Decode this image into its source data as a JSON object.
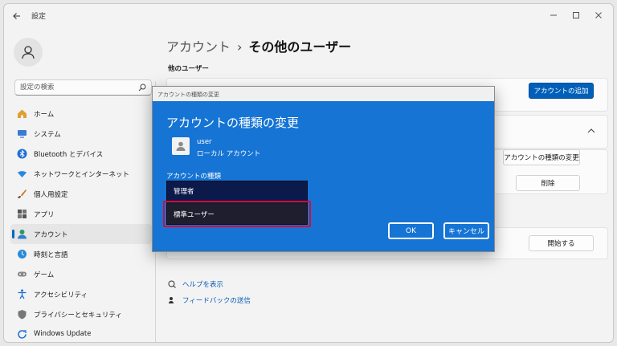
{
  "app": {
    "title": "設定"
  },
  "sidebar": {
    "search_placeholder": "設定の検索",
    "items": [
      {
        "label": "ホーム",
        "icon": "home-icon"
      },
      {
        "label": "システム",
        "icon": "monitor-icon"
      },
      {
        "label": "Bluetooth とデバイス",
        "icon": "bluetooth-icon"
      },
      {
        "label": "ネットワークとインターネット",
        "icon": "wifi-icon"
      },
      {
        "label": "個人用設定",
        "icon": "brush-icon"
      },
      {
        "label": "アプリ",
        "icon": "apps-icon"
      },
      {
        "label": "アカウント",
        "icon": "account-icon",
        "active": true
      },
      {
        "label": "時刻と言語",
        "icon": "globe-clock-icon"
      },
      {
        "label": "ゲーム",
        "icon": "gamepad-icon"
      },
      {
        "label": "アクセシビリティ",
        "icon": "accessibility-icon"
      },
      {
        "label": "プライバシーとセキュリティ",
        "icon": "shield-icon"
      },
      {
        "label": "Windows Update",
        "icon": "update-icon"
      }
    ]
  },
  "main": {
    "breadcrumb_parent": "アカウント",
    "breadcrumb_sep": "›",
    "breadcrumb_current": "その他のユーザー",
    "section_title": "他のユーザー",
    "add_account_label": "アカウントの追加",
    "change_type_label": "アカウントの種類の変更",
    "delete_label": "削除",
    "start_label": "開始する",
    "help_link": "ヘルプを表示",
    "feedback_link": "フィードバックの送信"
  },
  "dialog": {
    "window_title": "アカウントの種類の変更",
    "heading": "アカウントの種類の変更",
    "user_name": "user",
    "user_type": "ローカル アカウント",
    "field_label": "アカウントの種類",
    "options": [
      "管理者",
      "標準ユーザー"
    ],
    "ok_label": "OK",
    "cancel_label": "キャンセル"
  },
  "colors": {
    "accent": "#005fb8",
    "dialog_bg": "#1574d4",
    "highlight": "#d10e3a"
  }
}
